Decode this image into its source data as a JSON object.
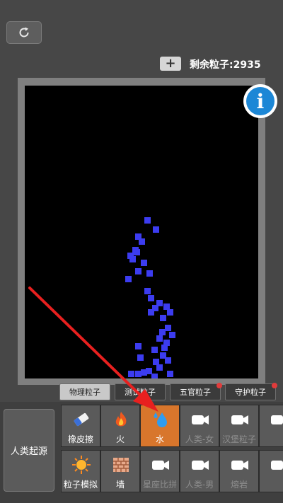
{
  "toolbar": {
    "reset_icon": "refresh-icon",
    "add_label": "+",
    "remaining_label": "剩余粒子:2935"
  },
  "info": {
    "label": "i"
  },
  "tabs": [
    {
      "label": "物理粒子",
      "active": true
    },
    {
      "label": "测试粒子"
    },
    {
      "label": "五官粒子",
      "badge": true
    },
    {
      "label": "守护粒子",
      "badge": true
    }
  ],
  "origin_button": {
    "label": "人类起源"
  },
  "items": [
    {
      "label": "橡皮擦",
      "icon": "eraser-icon"
    },
    {
      "label": "火",
      "icon": "fire-icon"
    },
    {
      "label": "水",
      "icon": "water-drop-icon",
      "selected": true
    },
    {
      "label": "人类-女",
      "icon": "video-icon",
      "locked": true
    },
    {
      "label": "汉堡粒子",
      "icon": "video-icon",
      "locked": true
    },
    {
      "label": "粒子模拟",
      "icon": "spark-icon"
    },
    {
      "label": "墙",
      "icon": "brick-wall-icon"
    },
    {
      "label": "星座比拼",
      "icon": "video-icon",
      "locked": true
    },
    {
      "label": "人类-男",
      "icon": "video-icon",
      "locked": true
    },
    {
      "label": "熔岩",
      "icon": "video-icon",
      "locked": true
    }
  ],
  "colors": {
    "water_particle": "#3c3cf0",
    "selected_item": "#d8762c",
    "annotation_arrow": "#e8201f"
  }
}
